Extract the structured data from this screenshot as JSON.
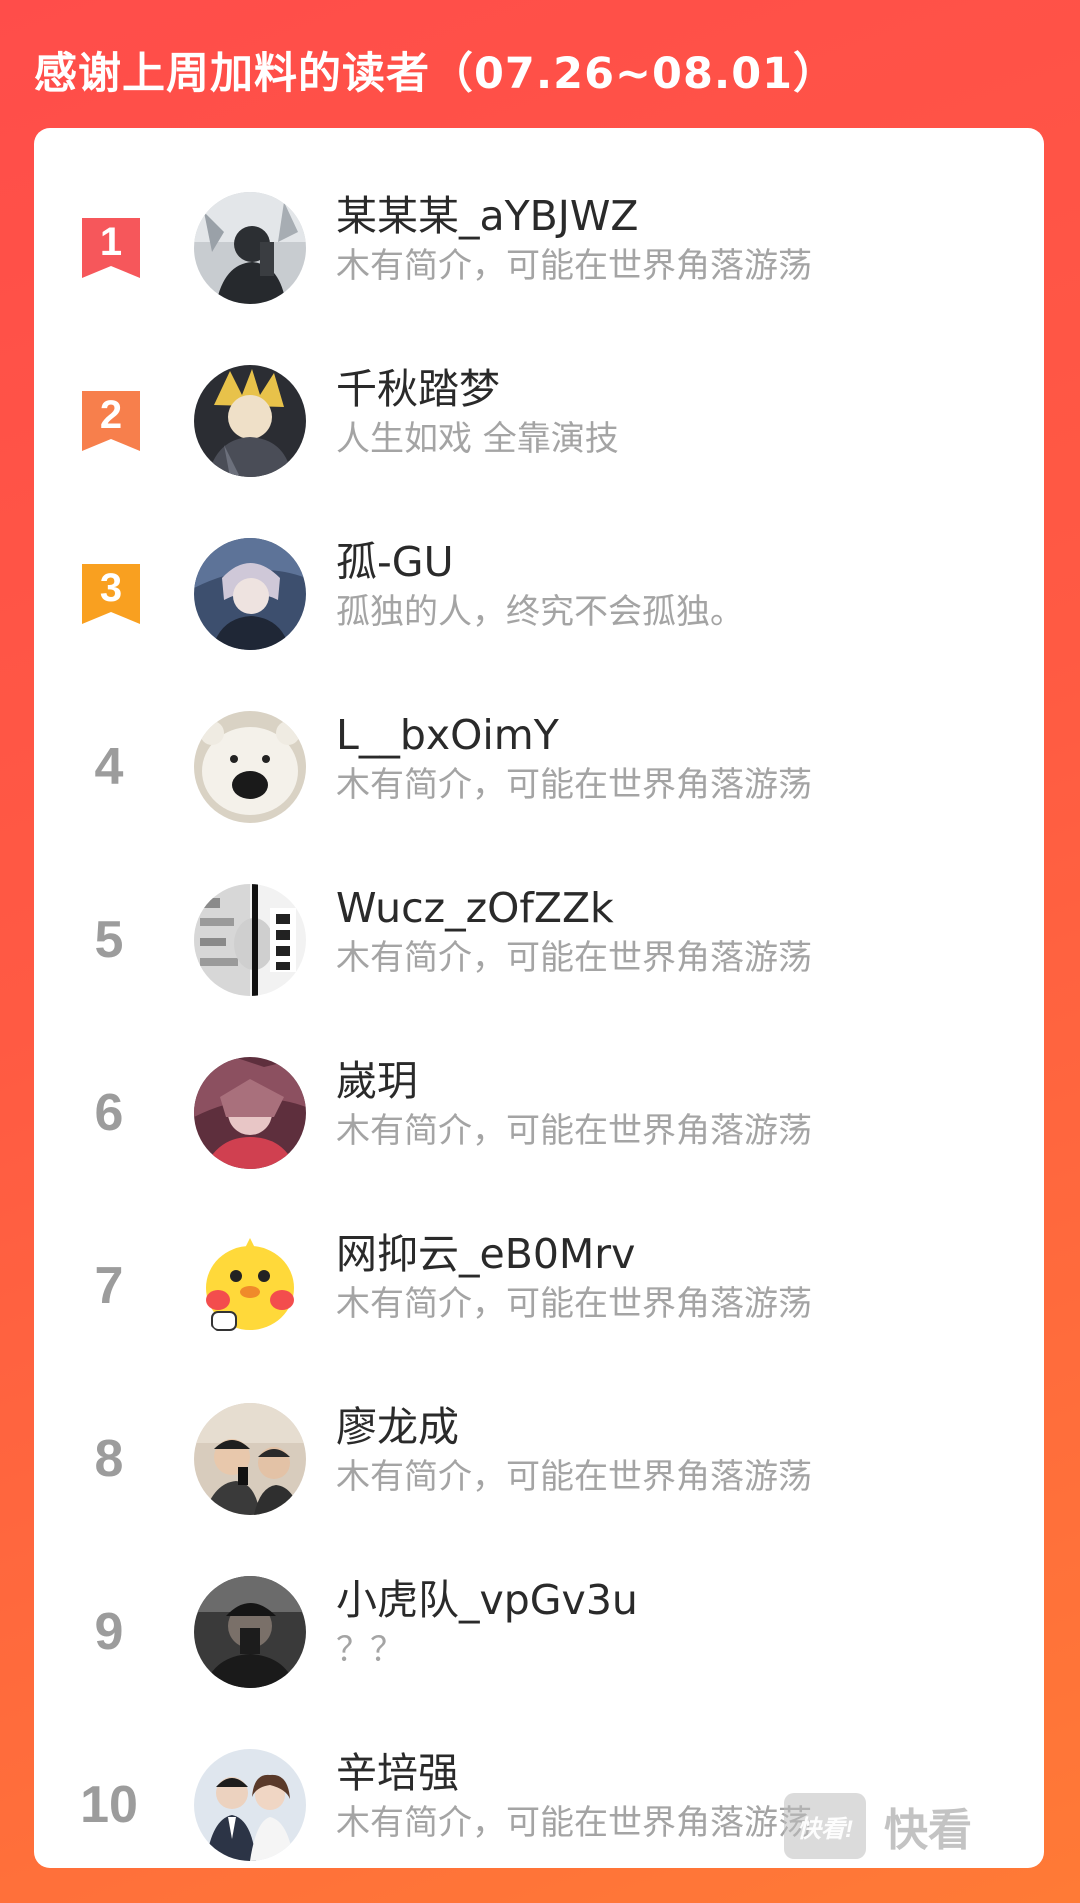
{
  "header": {
    "title": "感谢上周加料的读者（07.26~08.01）"
  },
  "colors": {
    "background_top": "#ff4d4a",
    "background_bottom": "#ff7a36",
    "rank1": "#f6575b",
    "rank2": "#f77f4c",
    "rank3": "#f9a020",
    "rank_gray": "#9c9c9c"
  },
  "readers": [
    {
      "rank": "1",
      "name": "某某某_aYBJWZ",
      "bio": "木有简介，可能在世界角落游荡",
      "avatar": "dark-silhouette-avatar"
    },
    {
      "rank": "2",
      "name": "千秋踏梦",
      "bio": "人生如戏 全靠演技",
      "avatar": "anime-blonde-avatar"
    },
    {
      "rank": "3",
      "name": "孤-GU",
      "bio": "孤独的人，终究不会孤独。",
      "avatar": "anime-boy-avatar"
    },
    {
      "rank": "4",
      "name": "L__bxOimY",
      "bio": "木有简介，可能在世界角落游荡",
      "avatar": "polar-bear-avatar"
    },
    {
      "rank": "5",
      "name": "Wucz_zOfZZk",
      "bio": "木有简介，可能在世界角落游荡",
      "avatar": "meme-avatar"
    },
    {
      "rank": "6",
      "name": "嵗玥",
      "bio": "木有简介，可能在世界角落游荡",
      "avatar": "anime-red-avatar"
    },
    {
      "rank": "7",
      "name": "网抑云_eB0Mrv",
      "bio": "木有简介，可能在世界角落游荡",
      "avatar": "yellow-duck-avatar"
    },
    {
      "rank": "8",
      "name": "廖龙成",
      "bio": "木有简介，可能在世界角落游荡",
      "avatar": "selfie-photo-avatar"
    },
    {
      "rank": "9",
      "name": "小虎队_vpGv3u",
      "bio": "？？",
      "avatar": "dark-selfie-avatar"
    },
    {
      "rank": "10",
      "name": "辛培强",
      "bio": "木有简介，可能在世界角落游荡",
      "avatar": "couple-photo-avatar"
    }
  ],
  "watermark": {
    "logo_text": "快看!",
    "text": "快看"
  }
}
